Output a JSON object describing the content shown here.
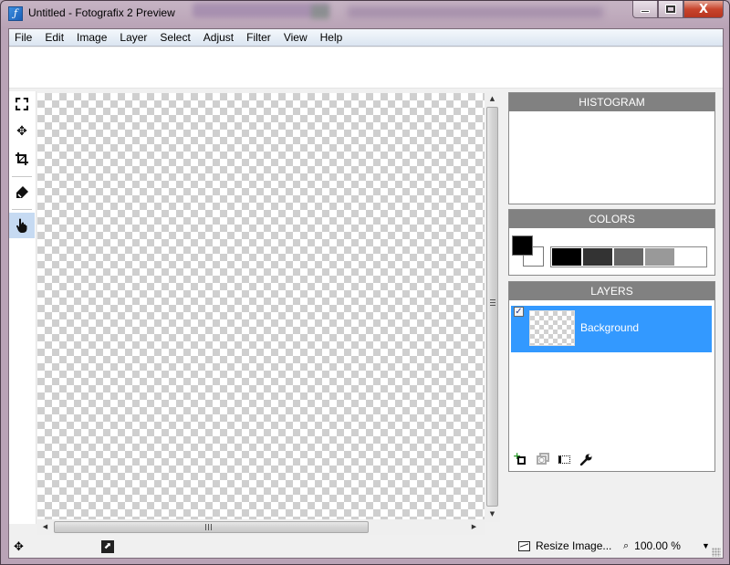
{
  "window": {
    "title": "Untitled - Fotografix 2 Preview",
    "app_icon_glyph": "ƒ",
    "caption_buttons": {
      "minimize": "minimize-icon",
      "maximize": "maximize-icon",
      "close_glyph": "X"
    }
  },
  "menubar": {
    "items": [
      "File",
      "Edit",
      "Image",
      "Layer",
      "Select",
      "Adjust",
      "Filter",
      "View",
      "Help"
    ]
  },
  "tools": [
    {
      "name": "rectangle-select-tool",
      "icon": "marquee-icon",
      "active": false
    },
    {
      "name": "move-tool",
      "icon": "move-icon",
      "glyph": "✥",
      "active": false
    },
    {
      "name": "crop-tool",
      "icon": "crop-icon",
      "active": false
    },
    {
      "name": "paint-bucket-tool",
      "icon": "paint-icon",
      "glyph": "🖌",
      "active": false
    },
    {
      "name": "hand-tool",
      "icon": "hand-icon",
      "glyph": "✋",
      "active": true
    }
  ],
  "panels": {
    "histogram": {
      "title": "HISTOGRAM"
    },
    "colors": {
      "title": "COLORS",
      "primary": "#000000",
      "secondary": "#ffffff",
      "palette": [
        "#000000",
        "#333333",
        "#666666",
        "#999999",
        "#ffffff"
      ]
    },
    "layers": {
      "title": "LAYERS",
      "items": [
        {
          "name": "Background",
          "visible": true,
          "selected": true,
          "check_glyph": "✓"
        }
      ],
      "tool_icons": [
        "add-layer-icon",
        "duplicate-layer-icon",
        "layer-properties-icon",
        "wrench-icon"
      ]
    }
  },
  "scrollbars": {
    "vertical": {
      "up": "▲",
      "down": "▼"
    },
    "horizontal": {
      "left": "◀",
      "right": "▶"
    }
  },
  "statusbar": {
    "move_glyph": "✥",
    "fit_glyph": "⬈",
    "resize_label": "Resize Image...",
    "zoom_glyph": "🔍",
    "zoom_value": "100.00 %",
    "dropdown_glyph": "▼"
  },
  "colors": {
    "selection_blue": "#3399ff",
    "panel_header": "#818181",
    "active_tool": "#c6daf2"
  }
}
